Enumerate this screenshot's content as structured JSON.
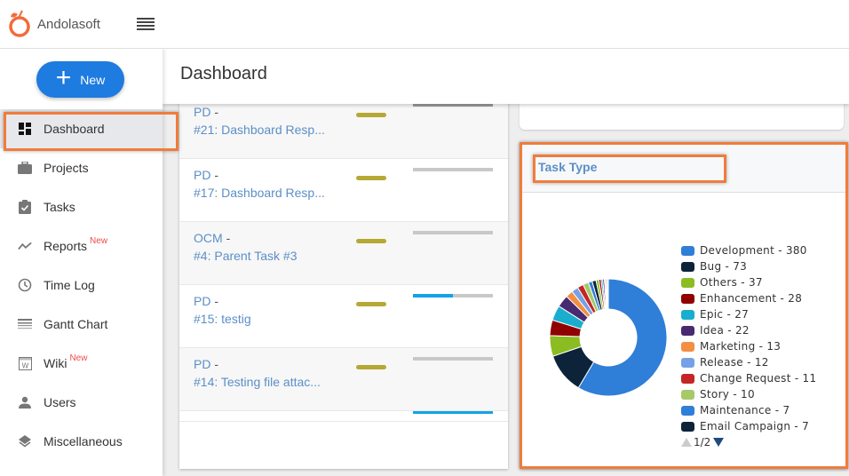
{
  "app": {
    "brand": "Andolasoft",
    "new_button_label": "New"
  },
  "sidebar": {
    "items": [
      {
        "label": "Dashboard",
        "icon": "dashboard-icon",
        "active": true,
        "badge": ""
      },
      {
        "label": "Projects",
        "icon": "briefcase-icon",
        "active": false,
        "badge": ""
      },
      {
        "label": "Tasks",
        "icon": "clipboard-check-icon",
        "active": false,
        "badge": ""
      },
      {
        "label": "Reports",
        "icon": "trending-icon",
        "active": false,
        "badge": "New"
      },
      {
        "label": "Time Log",
        "icon": "clock-icon",
        "active": false,
        "badge": ""
      },
      {
        "label": "Gantt Chart",
        "icon": "gantt-icon",
        "active": false,
        "badge": ""
      },
      {
        "label": "Wiki",
        "icon": "wiki-icon",
        "active": false,
        "badge": "New"
      },
      {
        "label": "Users",
        "icon": "user-icon",
        "active": false,
        "badge": ""
      },
      {
        "label": "Miscellaneous",
        "icon": "layers-icon",
        "active": false,
        "badge": ""
      }
    ]
  },
  "header": {
    "title": "Dashboard"
  },
  "tasks": [
    {
      "project": "PD",
      "title": "#21: Dashboard Resp...",
      "progress": 0,
      "progress_dark": true
    },
    {
      "project": "PD",
      "title": "#17: Dashboard Resp...",
      "progress": 0
    },
    {
      "project": "OCM",
      "title": "#4: Parent Task #3",
      "progress": 0
    },
    {
      "project": "PD",
      "title": "#15: testig",
      "progress": 50
    },
    {
      "project": "PD",
      "title": "#14: Testing file attac...",
      "progress": 0
    },
    {
      "project": "",
      "title": "",
      "progress": 100
    }
  ],
  "task_type": {
    "title": "Task Type",
    "pager": "1/2",
    "colors": {
      "highlight": "#f07c3c"
    }
  },
  "chart_data": {
    "type": "pie",
    "title": "Task Type",
    "donut": true,
    "legend_position": "right",
    "categories": [
      "Development",
      "Bug",
      "Others",
      "Enhancement",
      "Epic",
      "Idea",
      "Marketing",
      "Release",
      "Change Request",
      "Story",
      "Maintenance",
      "Email Campaign"
    ],
    "values": [
      380,
      73,
      37,
      28,
      27,
      22,
      13,
      12,
      11,
      10,
      7,
      7
    ],
    "colors": [
      "#2f7ed8",
      "#0d233a",
      "#8bbc21",
      "#910000",
      "#1aadce",
      "#492970",
      "#f28f43",
      "#77a1e5",
      "#c42525",
      "#a6c96a",
      "#2f7ed8",
      "#0d233a"
    ],
    "legend_labels": [
      "Development - 380",
      "Bug - 73",
      "Others - 37",
      "Enhancement - 28",
      "Epic - 27",
      "Idea - 22",
      "Marketing - 13",
      "Release - 12",
      "Change Request - 11",
      "Story - 10",
      "Maintenance - 7",
      "Email Campaign - 7"
    ],
    "extra_small_slices": [
      5,
      4,
      3,
      3,
      2,
      2,
      2,
      1
    ],
    "extra_slice_colors": [
      "#8bbc21",
      "#910000",
      "#1aadce",
      "#492970",
      "#f28f43",
      "#77a1e5",
      "#c42525",
      "#a6c96a"
    ]
  }
}
